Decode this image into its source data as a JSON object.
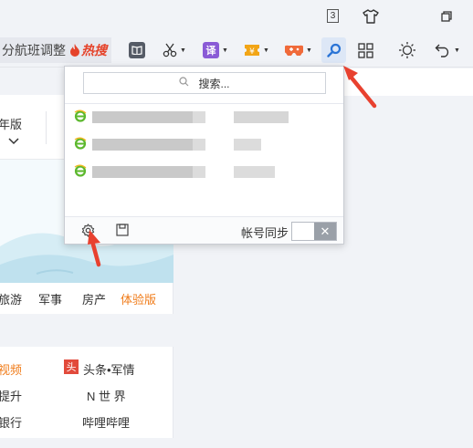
{
  "titlebar": {
    "tab_count": "3",
    "skin_icon": "tshirt-icon",
    "restore_icon": "restore-icon"
  },
  "toolbar": {
    "hot_text": "分航班调整",
    "hot_badge": "热搜",
    "translate_label": "译",
    "tools": [
      "reader-icon",
      "scissors-icon",
      "translate-icon",
      "coupon-icon",
      "game-icon",
      "search-icon",
      "apps-grid-icon",
      "brightness-icon",
      "undo-icon"
    ]
  },
  "left_card": {
    "version_text": "年版",
    "categories": [
      "旅游",
      "军事",
      "房产",
      "体验版"
    ]
  },
  "links_card": {
    "col1": [
      "视频",
      "提升",
      "银行"
    ],
    "col2_badge": "头",
    "col2": [
      "头条•军情",
      "N 世 界",
      "哔哩哔哩"
    ]
  },
  "popup": {
    "search_placeholder": "搜索...",
    "sync_label": "帐号同步",
    "toggle_off_symbol": "✕",
    "history_count": 3
  },
  "colors": {
    "accent_orange": "#f07c1a",
    "hot_red": "#e5432a",
    "search_blue": "#2a74d6",
    "annotation_red": "#e8412f"
  }
}
